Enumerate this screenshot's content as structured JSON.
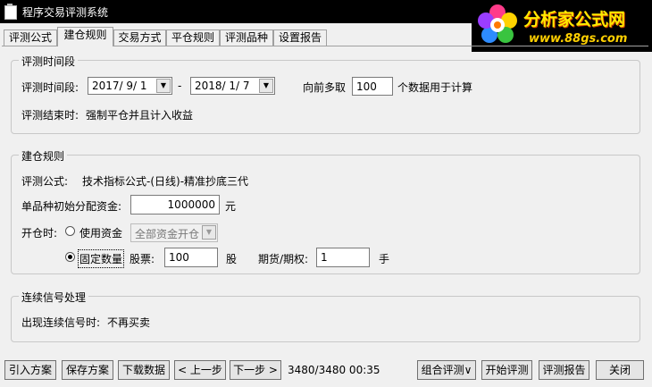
{
  "window": {
    "title": "程序交易评测系统"
  },
  "logo": {
    "brand": "分析家公式网",
    "url": "www.88gs.com"
  },
  "tabs": [
    "评测公式",
    "建仓规则",
    "交易方式",
    "平仓规则",
    "评测品种",
    "设置报告"
  ],
  "active_tab": "建仓规则",
  "period_group": {
    "legend": "评测时间段",
    "label": "评测时间段:",
    "start_date": "2017/ 9/ 1",
    "separator": "-",
    "end_date": "2018/ 1/ 7",
    "lookback_label": "向前多取",
    "lookback_value": "100",
    "lookback_suffix": "个数据用于计算",
    "end_label": "评测结束时:",
    "end_value": "强制平仓并且计入收益"
  },
  "position_group": {
    "legend": "建仓规则",
    "formula_label": "评测公式:",
    "formula_value": "技术指标公式-(日线)-精准抄底三代",
    "capital_label": "单品种初始分配资金:",
    "capital_value": "1000000",
    "capital_unit": "元",
    "open_label": "开仓时:",
    "option_capital": "使用资金",
    "capital_mode_value": "全部资金开仓",
    "option_fixed": "固定数量",
    "stock_label": "股票:",
    "stock_value": "100",
    "stock_unit": "股",
    "futures_label": "期货/期权:",
    "futures_value": "1",
    "futures_unit": "手",
    "selected_option": "固定数量"
  },
  "signal_group": {
    "legend": "连续信号处理",
    "label": "出现连续信号时:",
    "value": "不再买卖"
  },
  "bottom": {
    "import": "引入方案",
    "save": "保存方案",
    "download": "下载数据",
    "prev": "< 上一步",
    "next": "下一步 >",
    "status": "3480/3480 00:35",
    "combo": "组合评测∨",
    "start": "开始评测",
    "report": "评测报告",
    "close": "关闭"
  }
}
